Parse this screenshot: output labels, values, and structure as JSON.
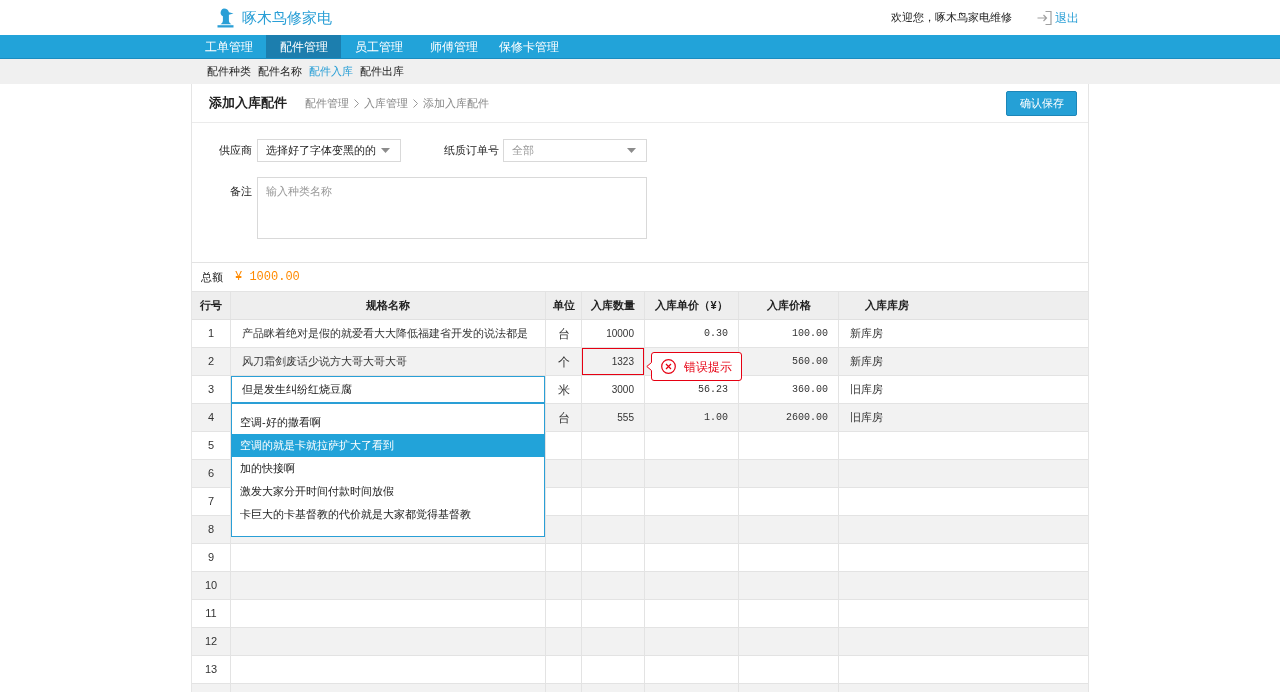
{
  "header": {
    "brand": "啄木鸟修家电",
    "welcome": "欢迎您，啄木鸟家电维修",
    "logout": "退出"
  },
  "nav": [
    {
      "label": "工单管理",
      "selected": false
    },
    {
      "label": "配件管理",
      "selected": true
    },
    {
      "label": "员工管理",
      "selected": false
    },
    {
      "label": "师傅管理",
      "selected": false
    },
    {
      "label": "保修卡管理",
      "selected": false
    }
  ],
  "subnav": [
    {
      "label": "配件种类",
      "selected": false
    },
    {
      "label": "配件名称",
      "selected": false
    },
    {
      "label": "配件入库",
      "selected": true
    },
    {
      "label": "配件出库",
      "selected": false
    }
  ],
  "page": {
    "title": "添加入库配件",
    "breadcrumb": [
      "配件管理",
      "入库管理",
      "添加入库配件"
    ],
    "save_button": "确认保存"
  },
  "form": {
    "supplier": {
      "label": "供应商",
      "value": "选择好了字体变黑的的"
    },
    "paper_order_no": {
      "label": "纸质订单号",
      "placeholder": "全部"
    },
    "remark": {
      "label": "备注",
      "placeholder": "输入种类名称"
    }
  },
  "total": {
    "label": "总额",
    "amount": "¥ 1000.00"
  },
  "table": {
    "columns": [
      "行号",
      "规格名称",
      "单位",
      "入库数量",
      "入库单价（¥）",
      "入库价格",
      "入库库房"
    ],
    "rows": [
      {
        "no": "1",
        "name": "产品眯着绝对是假的就爱看大大降低福建省开发的说法都是",
        "unit": "台",
        "quantity": "10000",
        "unit_price": "0.30",
        "price": "100.00",
        "warehouse": "新库房",
        "editing": false,
        "quantity_invalid": false
      },
      {
        "no": "2",
        "name": "风刀霜剑废话少说方大哥大哥大哥",
        "unit": "个",
        "quantity": "1323",
        "price": "560.00",
        "warehouse": "新库房",
        "editing": false,
        "quantity_invalid": true
      },
      {
        "no": "3",
        "name": "但是发生纠纷红烧豆腐",
        "unit": "米",
        "quantity": "3000",
        "unit_price": "56.23",
        "price": "360.00",
        "warehouse": "旧库房",
        "editing": true,
        "quantity_invalid": false
      },
      {
        "no": "4",
        "unit": "台",
        "quantity": "555",
        "unit_price": "1.00",
        "price": "2600.00",
        "warehouse": "旧库房",
        "editing": false,
        "quantity_invalid": false
      },
      {
        "no": "5",
        "editing": false,
        "quantity_invalid": false
      },
      {
        "no": "6",
        "editing": false,
        "quantity_invalid": false
      },
      {
        "no": "7",
        "editing": false,
        "quantity_invalid": false
      },
      {
        "no": "8",
        "editing": false,
        "quantity_invalid": false
      },
      {
        "no": "9",
        "editing": false,
        "quantity_invalid": false
      },
      {
        "no": "10",
        "editing": false,
        "quantity_invalid": false
      },
      {
        "no": "11",
        "editing": false,
        "quantity_invalid": false
      },
      {
        "no": "12",
        "editing": false,
        "quantity_invalid": false
      },
      {
        "no": "13",
        "editing": false,
        "quantity_invalid": false
      }
    ],
    "error_tip": "错误提示",
    "suggestions": [
      {
        "label": "空调-好的撒看啊",
        "selected": false
      },
      {
        "label": "空调的就是卡就拉萨扩大了看到",
        "selected": true
      },
      {
        "label": "加的快接啊",
        "selected": false
      },
      {
        "label": "激发大家分开时间付款时间放假",
        "selected": false
      },
      {
        "label": "卡巨大的卡基督教的代价就是大家都觉得基督教",
        "selected": false
      }
    ]
  }
}
